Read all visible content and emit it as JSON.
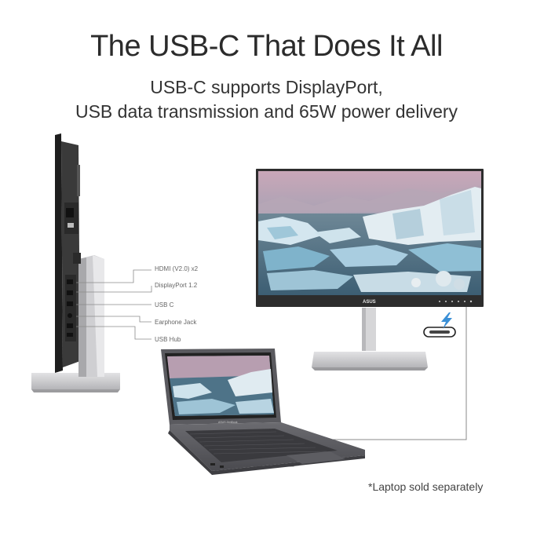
{
  "header": {
    "title": "The USB-C That Does It All",
    "subtitle_line1": "USB-C supports DisplayPort,",
    "subtitle_line2": "USB data transmission and 65W power delivery"
  },
  "ports": [
    {
      "label": "HDMI (V2.0) x2"
    },
    {
      "label": "DisplayPort 1.2"
    },
    {
      "label": "USB C"
    },
    {
      "label": "Earphone Jack"
    },
    {
      "label": "USB Hub"
    }
  ],
  "monitor_front": {
    "brand": "ASUS"
  },
  "laptop": {
    "brand": "ASUS ZenBook"
  },
  "footnote": "*Laptop sold separately",
  "colors": {
    "usb_bolt": "#3a8fd6",
    "bezel": "#2d2d2d",
    "stand": "#c9c9cc",
    "cable": "#8a8a8a"
  }
}
